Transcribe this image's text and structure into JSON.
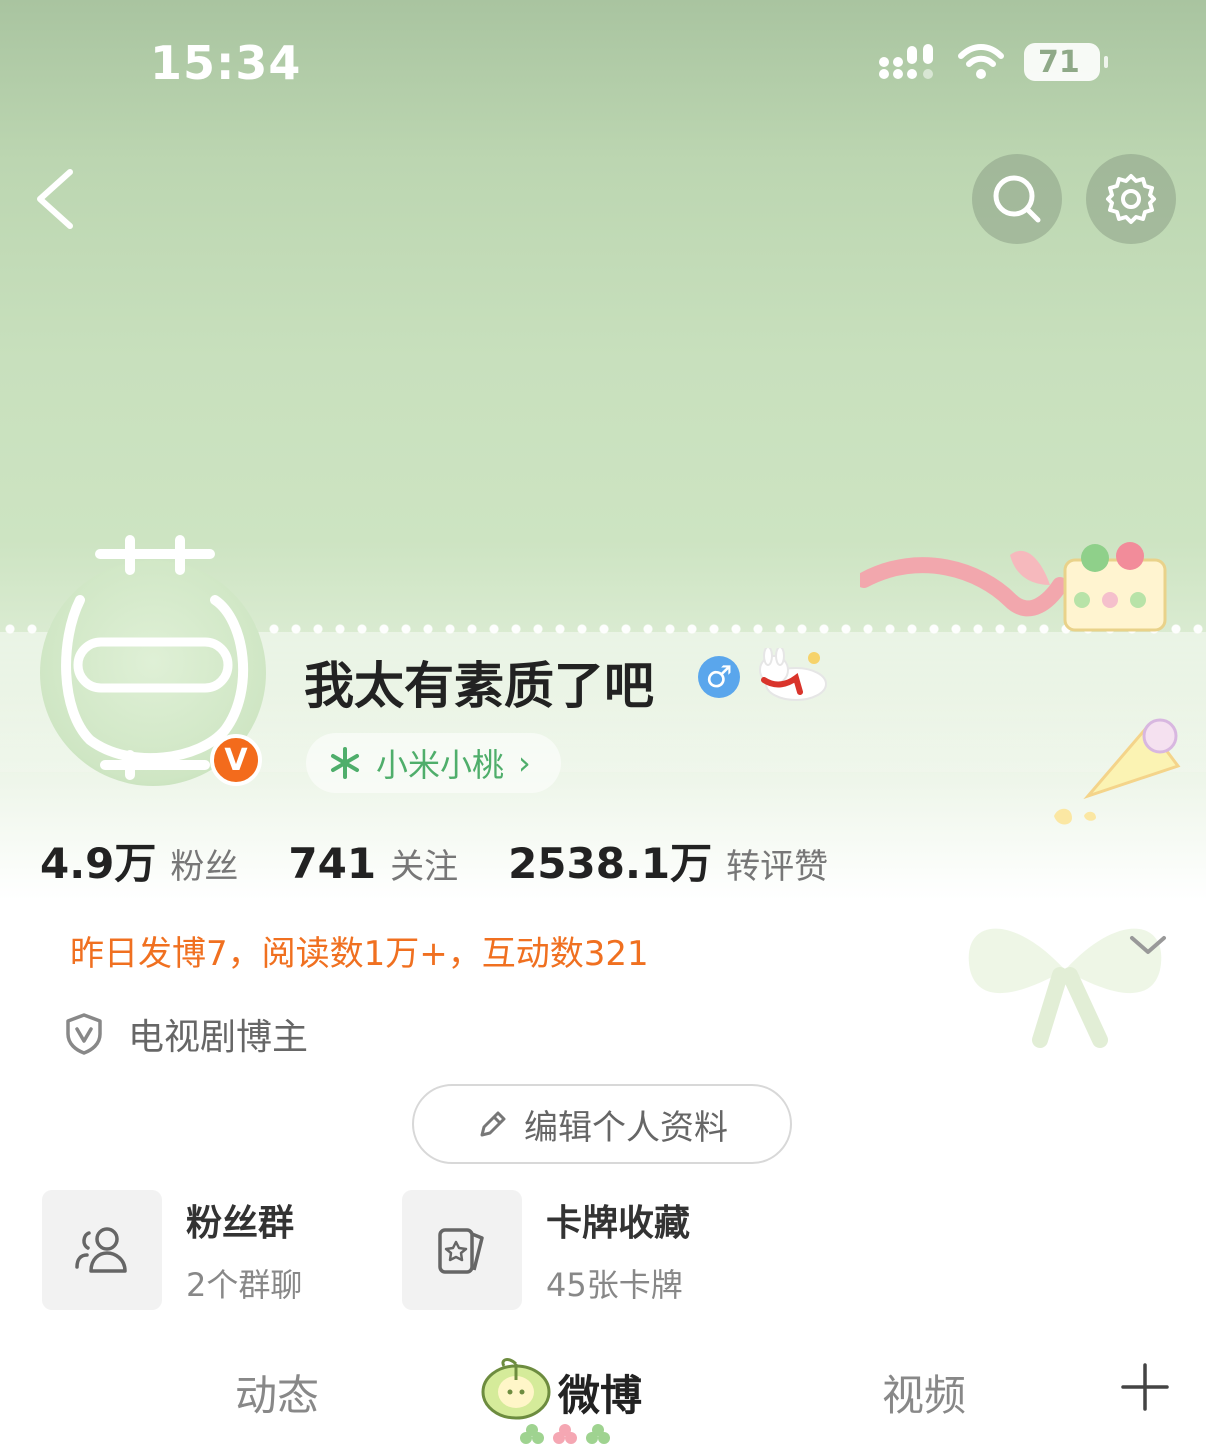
{
  "status_bar": {
    "time": "15:34",
    "battery": "71"
  },
  "profile": {
    "username": "我太有素质了吧",
    "gender_symbol": "♂",
    "vip_badge": "V",
    "tag": "小米小桃",
    "tag_arrow": "›"
  },
  "stats": [
    {
      "value": "4.9万",
      "label": "粉丝"
    },
    {
      "value": "741",
      "label": "关注"
    },
    {
      "value": "2538.1万",
      "label": "转评赞"
    }
  ],
  "highlight": "昨日发博7，阅读数1万+，互动数321",
  "verification": "电视剧博主",
  "edit_button": "编辑个人资料",
  "cards": [
    {
      "title": "粉丝群",
      "subtitle": "2个群聊",
      "icon": "users-icon"
    },
    {
      "title": "卡牌收藏",
      "subtitle": "45张卡牌",
      "icon": "card-icon"
    }
  ],
  "tabs": [
    "动态",
    "微博",
    "视频"
  ],
  "active_tab": "微博",
  "colors": {
    "accent_orange": "#f07020",
    "tag_green": "#4fae6b",
    "badge_orange": "#f36b1c",
    "gender_blue": "#5aa6ec"
  }
}
